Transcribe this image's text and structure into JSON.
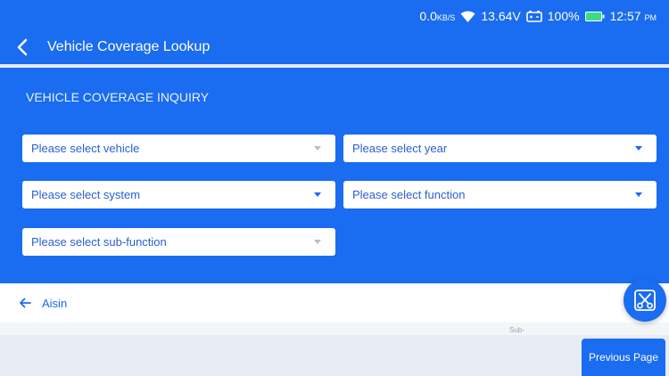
{
  "status_bar": {
    "speed_value": "0.0",
    "speed_unit": "KB/S",
    "voltage": "13.64V",
    "battery": "100%",
    "time": "12:57",
    "ampm": "PM"
  },
  "header": {
    "title": "Vehicle Coverage Lookup"
  },
  "panel": {
    "heading": "VEHICLE COVERAGE INQUIRY",
    "selects": {
      "vehicle": "Please select vehicle",
      "year": "Please select year",
      "system": "Please select system",
      "function": "Please select function",
      "sub_function": "Please select sub-function"
    }
  },
  "breadcrumb": {
    "label": "Aisin"
  },
  "table": {
    "partial_header": "Sub-"
  },
  "buttons": {
    "previous_page": "Previous Page"
  },
  "icons": {
    "back": "chevron-left-icon",
    "wifi": "wifi-icon",
    "car_battery": "car-battery-icon",
    "battery": "battery-icon",
    "breadcrumb_back": "arrow-left-icon",
    "fab": "scissors-icon"
  },
  "colors": {
    "primary": "#1a6cf0",
    "page_bg": "#e8ecf4",
    "battery_fill": "#3ddc84"
  }
}
